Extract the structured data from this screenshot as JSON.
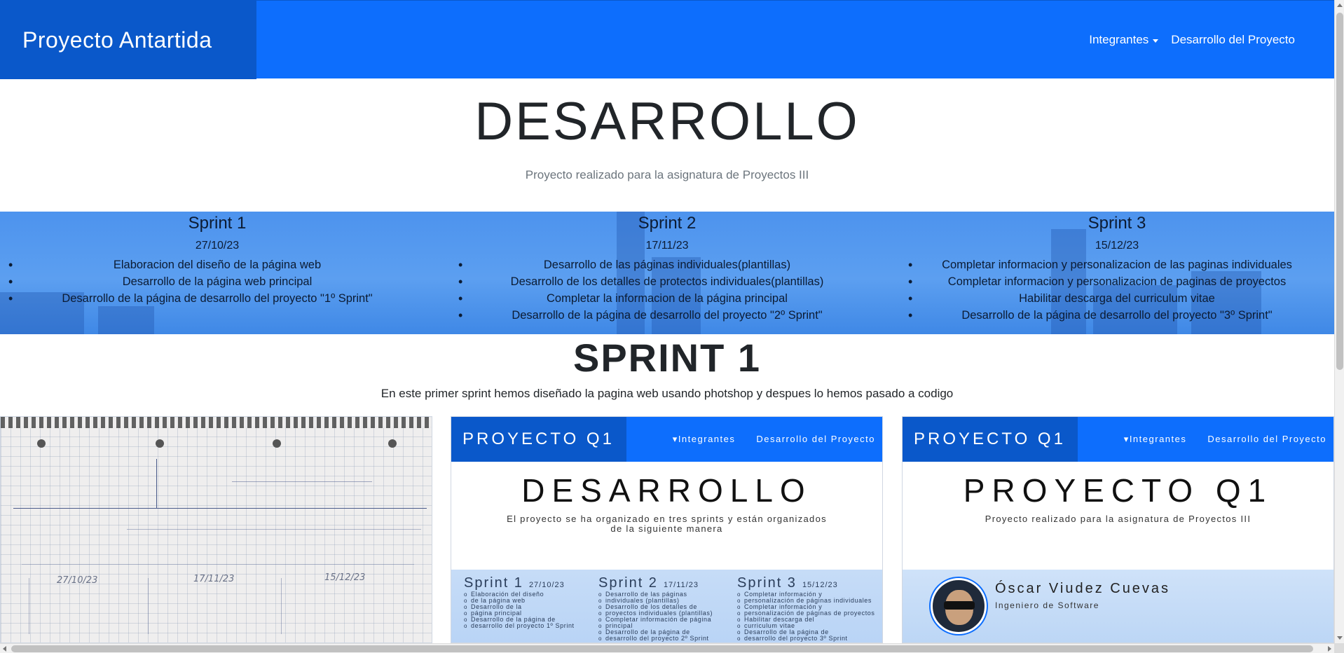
{
  "navbar": {
    "brand": "Proyecto Antartida",
    "links": [
      {
        "label": "Integrantes",
        "dropdown": true
      },
      {
        "label": "Desarrollo del Proyecto",
        "dropdown": false
      }
    ],
    "color": "#0d6efd",
    "brand_color": "#0a58ca"
  },
  "hero": {
    "title": "DESARROLLO",
    "subtitle": "Proyecto realizado para la asignatura de Proyectos III"
  },
  "sprints": [
    {
      "title": "Sprint 1",
      "date": "27/10/23",
      "items": [
        "Elaboracion del diseño de la página web",
        "Desarrollo de la página web principal",
        "Desarrollo de la página de desarrollo del proyecto \"1º Sprint\""
      ]
    },
    {
      "title": "Sprint 2",
      "date": "17/11/23",
      "items": [
        "Desarrollo de las páginas individuales(plantillas)",
        "Desarrollo de los detalles de protectos individuales(plantillas)",
        "Completar la informacion de la página principal",
        "Desarrollo de la página de desarrollo del proyecto \"2º Sprint\""
      ]
    },
    {
      "title": "Sprint 3",
      "date": "15/12/23",
      "items": [
        "Completar informacion y personalizacion de las paginas individuales",
        "Completar informacion y personalizacion de paginas de proyectos",
        "Habilitar descarga del curriculum vitae",
        "Desarrollo de la página de desarrollo del proyecto \"3º Sprint\""
      ]
    }
  ],
  "sprint1_section": {
    "title": "SPRINT 1",
    "text": "En este primer sprint hemos diseñado la pagina web usando photshop y despues lo hemos pasado a codigo"
  },
  "sketch": {
    "labels": [
      "27/10/23",
      "17/11/23",
      "15/12/23"
    ]
  },
  "mockup_dev": {
    "brand": "PROYECTO Q1",
    "nav": [
      "▾Integrantes",
      "Desarrollo del Proyecto"
    ],
    "title": "DESARROLLO",
    "subtitle_line1": "El proyecto se ha organizado en tres sprints y están organizados",
    "subtitle_line2": "de la siguiente manera",
    "cols": [
      {
        "title": "Sprint 1",
        "date": "27/10/23",
        "items": [
          "Elaboración del diseño",
          "de la página web",
          "Desarrollo de la",
          "página principal",
          "Desarrollo de la página de",
          "desarrollo del proyecto 1º Sprint"
        ]
      },
      {
        "title": "Sprint 2",
        "date": "17/11/23",
        "items": [
          "Desarrollo de las páginas",
          "individuales (plantillas)",
          "Desarrollo de los detalles de",
          "proyectos individuales (plantillas)",
          "Completar información de página",
          "principal",
          "Desarrollo de la página de",
          "desarrollo del proyecto 2º Sprint"
        ]
      },
      {
        "title": "Sprint 3",
        "date": "15/12/23",
        "items": [
          "Completar información y",
          "personalización de páginas individuales",
          "Completar información y",
          "personalización de páginas de proyectos",
          "Habilitar descarga del",
          "curriculum vitae",
          "Desarrollo de la página de",
          "desarrollo del proyecto 3º Sprint"
        ]
      }
    ]
  },
  "mockup_home": {
    "brand": "PROYECTO Q1",
    "nav": [
      "▾Integrantes",
      "Desarrollo del Proyecto"
    ],
    "title": "PROYECTO Q1",
    "subtitle": "Proyecto realizado para la asignatura de Proyectos III",
    "person_name": "Óscar Viudez Cuevas",
    "person_role": "Ingeniero de Software"
  }
}
